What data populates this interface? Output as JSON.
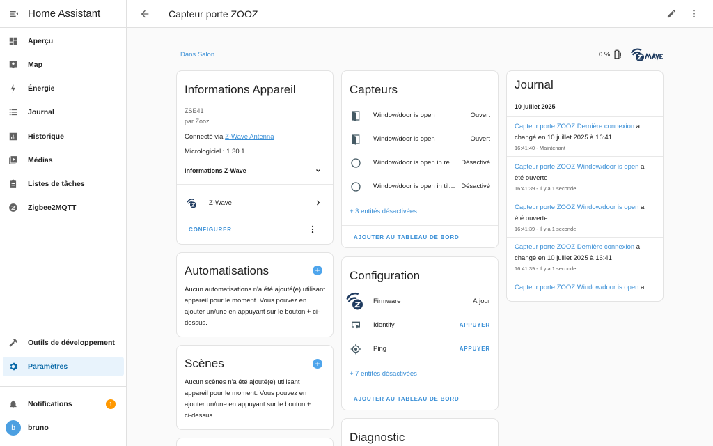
{
  "app": {
    "title": "Home Assistant"
  },
  "sidebar": {
    "items": [
      {
        "label": "Aperçu",
        "icon": "dashboard-icon"
      },
      {
        "label": "Map",
        "icon": "map-icon"
      },
      {
        "label": "Énergie",
        "icon": "lightning-icon"
      },
      {
        "label": "Journal",
        "icon": "list-icon"
      },
      {
        "label": "Historique",
        "icon": "chart-icon"
      },
      {
        "label": "Médias",
        "icon": "media-icon"
      },
      {
        "label": "Listes de tâches",
        "icon": "clipboard-icon"
      },
      {
        "label": "Zigbee2MQTT",
        "icon": "zigbee-icon"
      }
    ],
    "dev_tools": "Outils de développement",
    "settings": "Paramètres",
    "notifications": "Notifications",
    "notifications_count": "1",
    "user_initial": "b",
    "user_name": "bruno"
  },
  "header": {
    "title": "Capteur porte ZOOZ"
  },
  "area": {
    "label": "Dans Salon"
  },
  "battery": {
    "text": "0 %"
  },
  "device_info": {
    "title": "Informations Appareil",
    "model": "ZSE41",
    "manufacturer": "par Zooz",
    "connected_prefix": "Connecté via ",
    "connected_link": "Z-Wave Antenna",
    "firmware": "Micrologiciel : 1.30.1",
    "zwave_info": "Informations Z-Wave",
    "integration": "Z-Wave",
    "configure": "CONFIGURER"
  },
  "automations": {
    "title": "Automatisations",
    "text": "Aucun automatisations n'a été ajouté(e) utilisant appareil pour le moment. Vous pouvez en ajouter un/une en appuyant sur le bouton + ci-dessus."
  },
  "scenes": {
    "title": "Scènes",
    "text": "Aucun scènes n'a été ajouté(e) utilisant appareil pour le moment. Vous pouvez en ajouter un/une en appuyant sur le bouton + ci-dessus."
  },
  "sensors": {
    "title": "Capteurs",
    "entities": [
      {
        "name": "Window/door is open",
        "state": "Ouvert"
      },
      {
        "name": "Window/door is open",
        "state": "Ouvert"
      },
      {
        "name": "Window/door is open in regular mode",
        "state": "Désactivé"
      },
      {
        "name": "Window/door is open in tilt mode",
        "state": "Désactivé"
      }
    ],
    "disabled": "+ 3 entités désactivées",
    "add_dashboard": "AJOUTER AU TABLEAU DE BORD"
  },
  "configuration": {
    "title": "Configuration",
    "entities": [
      {
        "name": "Firmware",
        "state": "À jour"
      },
      {
        "name": "Identify",
        "button": "APPUYER"
      },
      {
        "name": "Ping",
        "button": "APPUYER"
      }
    ],
    "disabled": "+ 7 entités désactivées",
    "add_dashboard": "AJOUTER AU TABLEAU DE BORD"
  },
  "diagnostic": {
    "title": "Diagnostic"
  },
  "logbook": {
    "title": "Journal",
    "date": "10 juillet 2025",
    "entries": [
      {
        "link": "Capteur porte ZOOZ Dernière connexion",
        "line1_rest": " a",
        "line2": "changé en 10 juillet 2025 à 16:41",
        "time": "16:41:40 - Maintenant"
      },
      {
        "link": "Capteur porte ZOOZ Window/door is open",
        "line1_rest": " a",
        "line2": "été ouverte",
        "time": "16:41:39 - Il y a 1 seconde"
      },
      {
        "link": "Capteur porte ZOOZ Window/door is open",
        "line1_rest": " a",
        "line2": "été ouverte",
        "time": "16:41:39 - Il y a 1 seconde"
      },
      {
        "link": "Capteur porte ZOOZ Dernière connexion",
        "line1_rest": " a",
        "line2": "changé en 10 juillet 2025 à 16:41",
        "time": "16:41:39 - Il y a 1 seconde"
      },
      {
        "link": "Capteur porte ZOOZ Window/door is open",
        "line1_rest": " a",
        "line2": "",
        "time": ""
      }
    ]
  },
  "colors": {
    "accent": "#3a8fd6",
    "badge": "#ff9800",
    "active_bg": "#e8f3fc"
  }
}
